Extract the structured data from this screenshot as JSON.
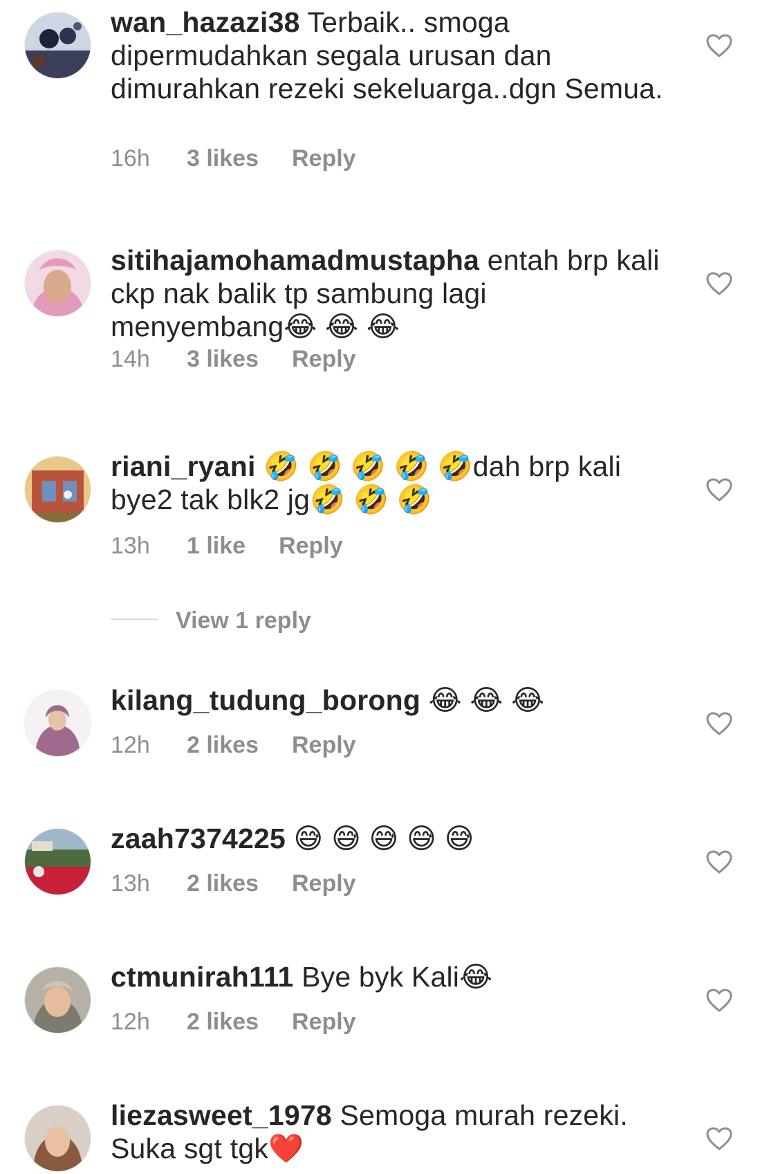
{
  "comments": [
    {
      "username": "wan_hazazi38",
      "text": " Terbaik.. smoga dipermudahkan segala urusan dan dimurahkan rezeki sekeluarga..dgn Semua.",
      "time": "16h",
      "likes": "3 likes",
      "reply_label": "Reply"
    },
    {
      "username": "sitihajamohamadmustapha",
      "text": " entah brp kali ckp nak balik tp sambung lagi menyembang😂 😂 😂",
      "time": "14h",
      "likes": "3 likes",
      "reply_label": "Reply"
    },
    {
      "username": "riani_ryani",
      "text": " 🤣 🤣 🤣 🤣 🤣dah brp kali bye2 tak blk2 jg🤣 🤣 🤣",
      "time": "13h",
      "likes": "1 like",
      "reply_label": "Reply",
      "view_replies": "View 1 reply"
    },
    {
      "username": "kilang_tudung_borong",
      "text": " 😂 😂 😂",
      "time": "12h",
      "likes": "2 likes",
      "reply_label": "Reply"
    },
    {
      "username": "zaah7374225",
      "text": " 😅 😅 😅 😅 😅",
      "time": "13h",
      "likes": "2 likes",
      "reply_label": "Reply"
    },
    {
      "username": "ctmunirah111",
      "text": " Bye byk Kali😂",
      "time": "12h",
      "likes": "2 likes",
      "reply_label": "Reply"
    },
    {
      "username": "liezasweet_1978",
      "text": " Semoga murah rezeki. Suka sgt tgk❤️",
      "time": "",
      "likes": "",
      "reply_label": ""
    }
  ],
  "icons": {
    "like": "heart-outline-icon"
  },
  "colors": {
    "text": "#262626",
    "secondary": "#8e8e8e",
    "divider": "#dbdbdb",
    "background": "#ffffff"
  }
}
